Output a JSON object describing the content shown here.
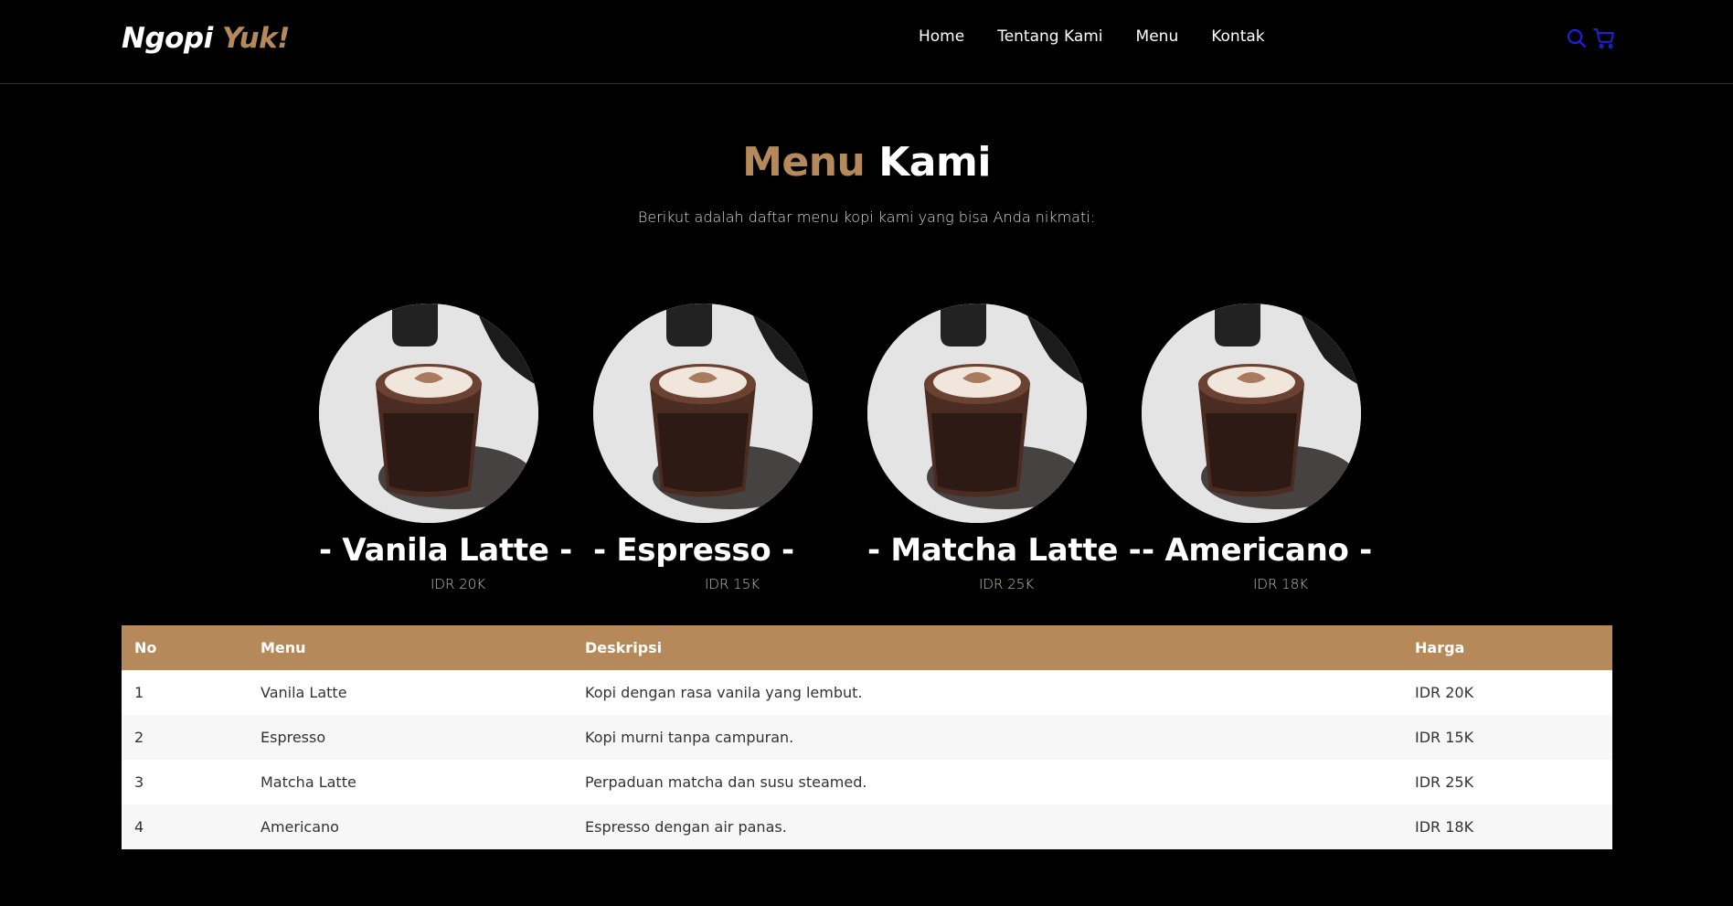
{
  "brand": {
    "name_main": "Ngopi",
    "name_accent": "Yuk!"
  },
  "nav": {
    "links": [
      {
        "label": "Home"
      },
      {
        "label": "Tentang Kami"
      },
      {
        "label": "Menu"
      },
      {
        "label": "Kontak"
      }
    ],
    "icons": [
      "search-icon",
      "shopping-cart-icon"
    ]
  },
  "section": {
    "title_accent": "Menu",
    "title_main": "Kami",
    "subtitle": "Berikut adalah daftar menu kopi kami yang bisa Anda nikmati:"
  },
  "cards": [
    {
      "name": "- Vanila Latte -",
      "price": "IDR 20K"
    },
    {
      "name": "- Espresso -",
      "price": "IDR 15K"
    },
    {
      "name": "- Matcha Latte -",
      "price": "IDR 25K"
    },
    {
      "name": "- Americano -",
      "price": "IDR 18K"
    }
  ],
  "table": {
    "headers": {
      "no": "No",
      "menu": "Menu",
      "desc": "Deskripsi",
      "price": "Harga"
    },
    "rows": [
      {
        "no": "1",
        "menu": "Vanila Latte",
        "desc": "Kopi dengan rasa vanila yang lembut.",
        "price": "IDR 20K"
      },
      {
        "no": "2",
        "menu": "Espresso",
        "desc": "Kopi murni tanpa campuran.",
        "price": "IDR 15K"
      },
      {
        "no": "3",
        "menu": "Matcha Latte",
        "desc": "Perpaduan matcha dan susu steamed.",
        "price": "IDR 25K"
      },
      {
        "no": "4",
        "menu": "Americano",
        "desc": "Espresso dengan air panas.",
        "price": "IDR 18K"
      }
    ]
  },
  "colors": {
    "accent": "#b6895b",
    "background": "#000000",
    "icon": "#1f1fe0"
  }
}
